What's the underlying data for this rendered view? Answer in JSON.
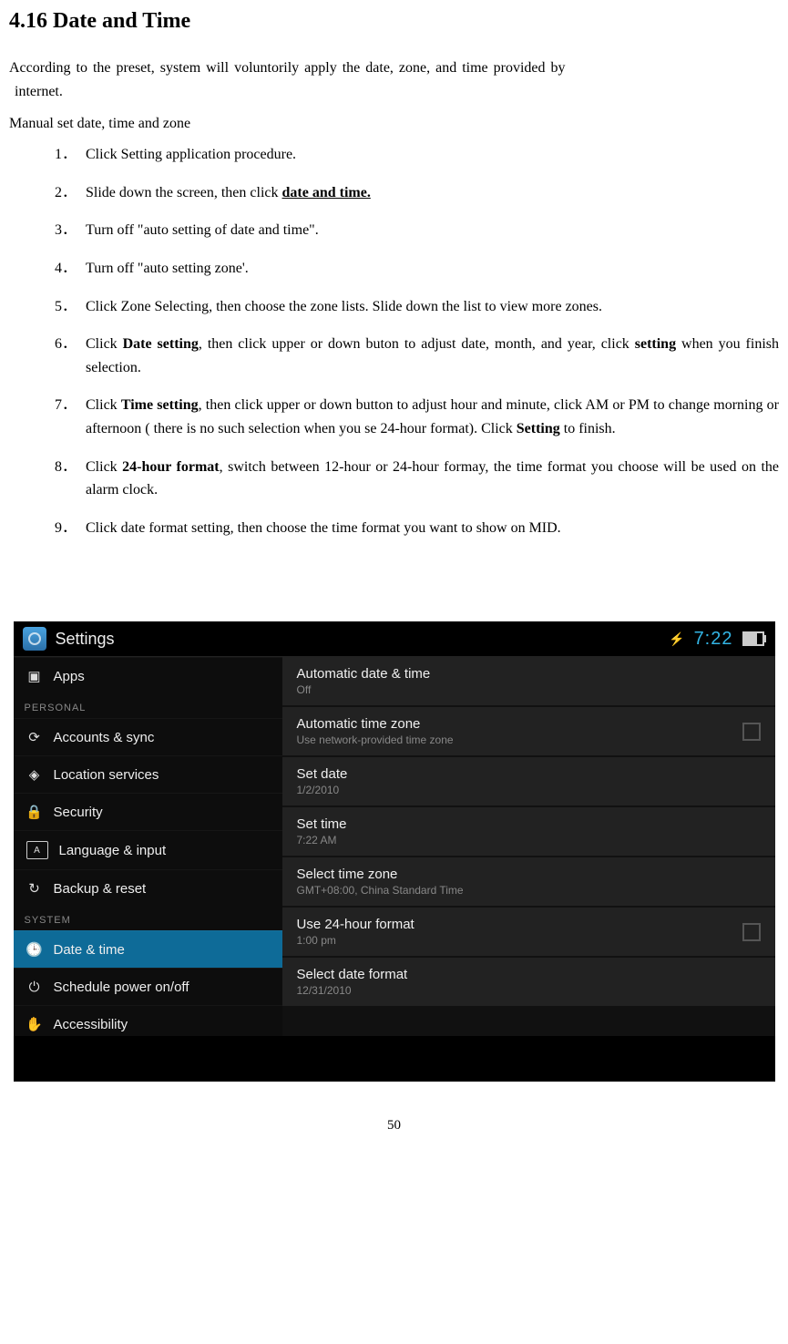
{
  "section_title": "4.16 Date and Time",
  "intro_line1": "According to the preset, system will voluntorily apply the date, zone, and time provided by",
  "intro_line2": "internet.",
  "subhead": "Manual set date, time and zone",
  "steps": {
    "s1": "Click Setting application procedure.",
    "s2a": "Slide down the screen, then click ",
    "s2b": "date and time.",
    "s3": "Turn off \"auto setting of date and time\".",
    "s4": "Turn off \"auto setting zone'.",
    "s5": "Click Zone Selecting, then choose the zone lists. Slide down the list to view more zones.",
    "s6a": "Click ",
    "s6b": "Date setting",
    "s6c": ", then click upper or down buton to adjust date, month, and year, click ",
    "s6d": "setting",
    "s6e": " when you finish selection.",
    "s7a": "Click ",
    "s7b": "Time setting",
    "s7c": ", then click upper or down button to adjust hour and minute, click AM or PM to change morning or afternoon ( there is no such selection when you se 24-hour format). Click ",
    "s7d": "Setting",
    "s7e": " to finish.",
    "s8a": "Click ",
    "s8b": "24-hour format",
    "s8c": ", switch between 12-hour or 24-hour formay, the time format you choose will be used on the alarm clock.",
    "s9": "Click date format setting, then choose the time format you want to show on MID."
  },
  "page_number": "50",
  "screenshot": {
    "header_title": "Settings",
    "clock": "7:22",
    "charge_glyph": "⚡",
    "sidebar": {
      "apps": "Apps",
      "cat_personal": "PERSONAL",
      "accounts": "Accounts & sync",
      "location": "Location services",
      "security": "Security",
      "language": "Language & input",
      "backup": "Backup & reset",
      "cat_system": "SYSTEM",
      "datetime": "Date & time",
      "schedule": "Schedule power on/off",
      "accessibility": "Accessibility"
    },
    "main": {
      "auto_dt_t": "Automatic date & time",
      "auto_dt_s": "Off",
      "auto_tz_t": "Automatic time zone",
      "auto_tz_s": "Use network-provided time zone",
      "set_date_t": "Set date",
      "set_date_s": "1/2/2010",
      "set_time_t": "Set time",
      "set_time_s": "7:22 AM",
      "sel_tz_t": "Select time zone",
      "sel_tz_s": "GMT+08:00, China Standard Time",
      "fmt24_t": "Use 24-hour format",
      "fmt24_s": "1:00 pm",
      "datefmt_t": "Select date format",
      "datefmt_s": "12/31/2010"
    }
  }
}
